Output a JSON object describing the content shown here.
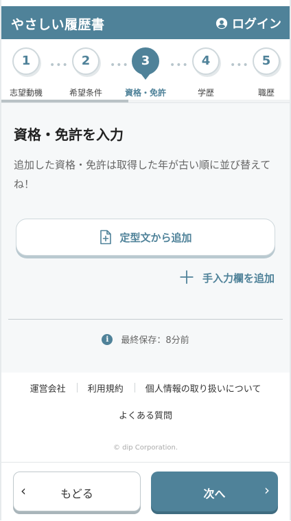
{
  "header": {
    "title": "やさしい履歴書",
    "login_label": "ログイン"
  },
  "stepper": {
    "progress_fraction": 0.44,
    "steps": [
      {
        "number": "1",
        "label": "志望動機",
        "active": false
      },
      {
        "number": "2",
        "label": "希望条件",
        "active": false
      },
      {
        "number": "3",
        "label": "資格・免許",
        "active": true
      },
      {
        "number": "4",
        "label": "学歴",
        "active": false
      },
      {
        "number": "5",
        "label": "職歴",
        "active": false
      }
    ],
    "separator": "•••"
  },
  "main": {
    "heading": "資格・免許を入力",
    "description": "追加した資格・免許は取得した年が古い順に並び替えてね！",
    "template_button_label": "定型文から追加",
    "manual_add_label": "手入力欄を追加",
    "save_status": "最終保存：8分前"
  },
  "footer": {
    "links": [
      "運営会社",
      "利用規約",
      "個人情報の取り扱いについて"
    ],
    "faq": "よくある質問",
    "copyright": "© dip Corporation."
  },
  "nav": {
    "back_label": "もどる",
    "next_label": "次へ"
  },
  "colors": {
    "primary": "#4f8299",
    "background": "#f6f8f9"
  },
  "icons": [
    "user-circle-icon",
    "document-plus-icon",
    "plus-icon",
    "info-icon",
    "chevron-left-icon",
    "chevron-right-icon"
  ]
}
